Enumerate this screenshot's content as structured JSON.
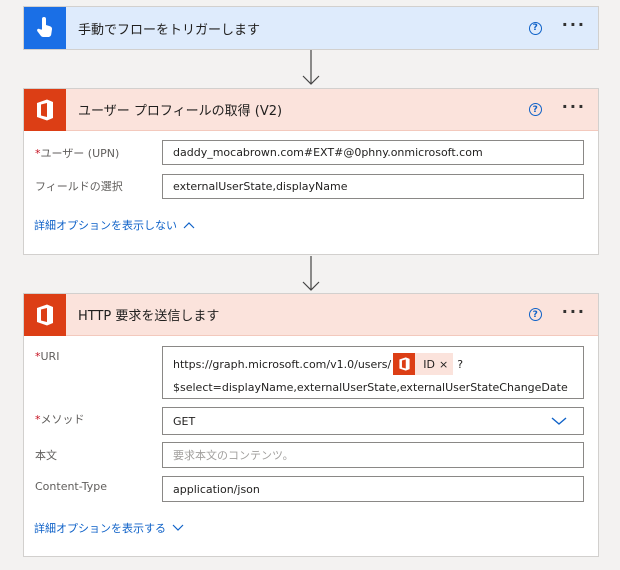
{
  "trigger_card": {
    "title": "手動でフローをトリガーします",
    "icon": "hand-tap-icon",
    "help": "?",
    "more": "···"
  },
  "user_profile_card": {
    "title": "ユーザー プロフィールの取得 (V2)",
    "icon": "office-icon",
    "help": "?",
    "more": "···",
    "fields": [
      {
        "label": "ユーザー (UPN)",
        "required": "*",
        "value": "daddy_mocabrown.com#EXT#@0phny.onmicrosoft.com"
      },
      {
        "label": "フィールドの選択",
        "required": "",
        "value": "externalUserState,displayName"
      }
    ],
    "advanced_link": "詳細オプションを表示しない"
  },
  "http_card": {
    "title": "HTTP 要求を送信します",
    "icon": "office-icon",
    "help": "?",
    "more": "···",
    "uri": {
      "label": "URI",
      "required": "*",
      "prefix": "https://graph.microsoft.com/v1.0/users/",
      "token": {
        "label": "ID",
        "close": "×"
      },
      "suffix": "?",
      "line2": "$select=displayName,externalUserState,externalUserStateChangeDate"
    },
    "method": {
      "label": "メソッド",
      "required": "*",
      "value": "GET"
    },
    "body": {
      "label": "本文",
      "placeholder": "要求本文のコンテンツ。"
    },
    "content_type": {
      "label": "Content-Type",
      "value": "application/json"
    },
    "advanced_link": "詳細オプションを表示する"
  },
  "colors": {
    "trigger_accent": "#1a6fe6",
    "office_accent": "#dc3e15",
    "link": "#0f62c8",
    "required": "#c50f1f"
  }
}
